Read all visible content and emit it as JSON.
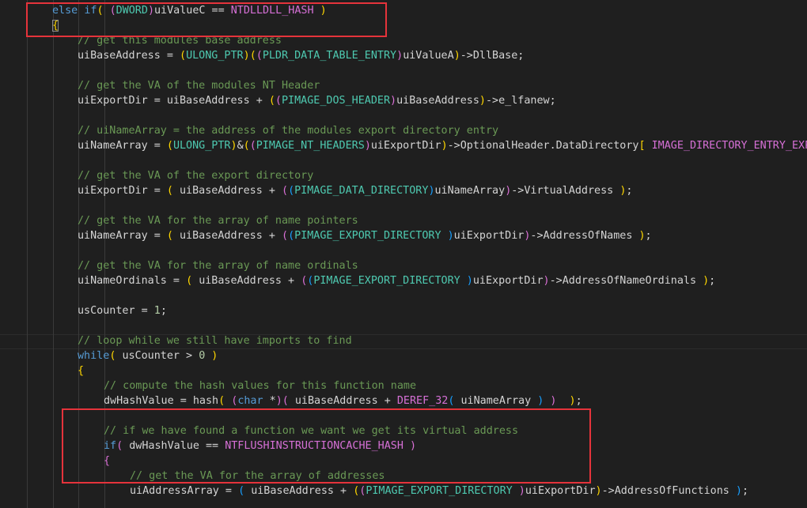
{
  "colors": {
    "background": "#1f1f1f",
    "keyword": "#569cd6",
    "comment": "#6a9955",
    "type": "#4ec9b0",
    "macro": "#d670d6",
    "bracket_gold": "#ffd700",
    "bracket_orchid": "#da70d6",
    "bracket_blue": "#179fff",
    "highlight_box": "#e5333b"
  },
  "code_lines": [
    [
      [
        "k",
        "else "
      ],
      [
        "k",
        "if"
      ],
      [
        "y",
        "( "
      ],
      [
        "m",
        "("
      ],
      [
        "t",
        "DWORD"
      ],
      [
        "m",
        ")"
      ],
      [
        "d",
        "uiValueC == "
      ],
      [
        "p",
        "NTDLLDLL_HASH"
      ],
      [
        "y",
        " )"
      ]
    ],
    [
      [
        "bm",
        "{"
      ]
    ],
    [
      [
        "c",
        "// get this modules base address"
      ]
    ],
    [
      [
        "d",
        "uiBaseAddress = "
      ],
      [
        "y",
        "("
      ],
      [
        "t",
        "ULONG_PTR"
      ],
      [
        "y",
        ")"
      ],
      [
        "y",
        "("
      ],
      [
        "m",
        "("
      ],
      [
        "t",
        "PLDR_DATA_TABLE_ENTRY"
      ],
      [
        "m",
        ")"
      ],
      [
        "d",
        "uiValueA"
      ],
      [
        "y",
        ")"
      ],
      [
        "d",
        "->DllBase;"
      ]
    ],
    [],
    [
      [
        "c",
        "// get the VA of the modules NT Header"
      ]
    ],
    [
      [
        "d",
        "uiExportDir = uiBaseAddress + "
      ],
      [
        "y",
        "("
      ],
      [
        "m",
        "("
      ],
      [
        "t",
        "PIMAGE_DOS_HEADER"
      ],
      [
        "m",
        ")"
      ],
      [
        "d",
        "uiBaseAddress"
      ],
      [
        "y",
        ")"
      ],
      [
        "d",
        "->e_lfanew;"
      ]
    ],
    [],
    [
      [
        "c",
        "// uiNameArray = the address of the modules export directory entry"
      ]
    ],
    [
      [
        "d",
        "uiNameArray = "
      ],
      [
        "y",
        "("
      ],
      [
        "t",
        "ULONG_PTR"
      ],
      [
        "y",
        ")"
      ],
      [
        "d",
        "&"
      ],
      [
        "y",
        "("
      ],
      [
        "m",
        "("
      ],
      [
        "t",
        "PIMAGE_NT_HEADERS"
      ],
      [
        "m",
        ")"
      ],
      [
        "d",
        "uiExportDir"
      ],
      [
        "y",
        ")"
      ],
      [
        "d",
        "->OptionalHeader.DataDirectory"
      ],
      [
        "y",
        "[ "
      ],
      [
        "p",
        "IMAGE_DIRECTORY_ENTRY_EXPORT"
      ],
      [
        "y",
        " ]"
      ],
      [
        "d",
        ";"
      ]
    ],
    [],
    [
      [
        "c",
        "// get the VA of the export directory"
      ]
    ],
    [
      [
        "d",
        "uiExportDir = "
      ],
      [
        "y",
        "( "
      ],
      [
        "d",
        "uiBaseAddress + "
      ],
      [
        "m",
        "("
      ],
      [
        "b",
        "("
      ],
      [
        "t",
        "PIMAGE_DATA_DIRECTORY"
      ],
      [
        "b",
        ")"
      ],
      [
        "d",
        "uiNameArray"
      ],
      [
        "m",
        ")"
      ],
      [
        "d",
        "->VirtualAddress "
      ],
      [
        "y",
        ")"
      ],
      [
        "d",
        ";"
      ]
    ],
    [],
    [
      [
        "c",
        "// get the VA for the array of name pointers"
      ]
    ],
    [
      [
        "d",
        "uiNameArray = "
      ],
      [
        "y",
        "( "
      ],
      [
        "d",
        "uiBaseAddress + "
      ],
      [
        "m",
        "("
      ],
      [
        "b",
        "("
      ],
      [
        "t",
        "PIMAGE_EXPORT_DIRECTORY "
      ],
      [
        "b",
        ")"
      ],
      [
        "d",
        "uiExportDir"
      ],
      [
        "m",
        ")"
      ],
      [
        "d",
        "->AddressOfNames "
      ],
      [
        "y",
        ")"
      ],
      [
        "d",
        ";"
      ]
    ],
    [],
    [
      [
        "c",
        "// get the VA for the array of name ordinals"
      ]
    ],
    [
      [
        "d",
        "uiNameOrdinals = "
      ],
      [
        "y",
        "( "
      ],
      [
        "d",
        "uiBaseAddress + "
      ],
      [
        "m",
        "("
      ],
      [
        "b",
        "("
      ],
      [
        "t",
        "PIMAGE_EXPORT_DIRECTORY "
      ],
      [
        "b",
        ")"
      ],
      [
        "d",
        "uiExportDir"
      ],
      [
        "m",
        ")"
      ],
      [
        "d",
        "->AddressOfNameOrdinals "
      ],
      [
        "y",
        ")"
      ],
      [
        "d",
        ";"
      ]
    ],
    [],
    [
      [
        "d",
        "usCounter = "
      ],
      [
        "n",
        "1"
      ],
      [
        "d",
        ";"
      ]
    ],
    [],
    [
      [
        "c",
        "// loop while we still have imports to find"
      ]
    ],
    [
      [
        "k",
        "while"
      ],
      [
        "y",
        "( "
      ],
      [
        "d",
        "usCounter > "
      ],
      [
        "n",
        "0"
      ],
      [
        "y",
        " )"
      ]
    ],
    [
      [
        "y",
        "{"
      ]
    ],
    [
      [
        "c",
        "// compute the hash values for this function name"
      ]
    ],
    [
      [
        "d",
        "dwHashValue = hash"
      ],
      [
        "y",
        "( "
      ],
      [
        "m",
        "("
      ],
      [
        "k",
        "char"
      ],
      [
        "d",
        " *"
      ],
      [
        "m",
        ")"
      ],
      [
        "m",
        "( "
      ],
      [
        "d",
        "uiBaseAddress + "
      ],
      [
        "p",
        "DEREF_32"
      ],
      [
        "b",
        "( "
      ],
      [
        "d",
        "uiNameArray "
      ],
      [
        "b",
        ")"
      ],
      [
        "m",
        " )"
      ],
      [
        "y",
        "  )"
      ],
      [
        "d",
        ";"
      ]
    ],
    [],
    [
      [
        "c",
        "// if we have found a function we want we get its virtual address"
      ]
    ],
    [
      [
        "k",
        "if"
      ],
      [
        "m",
        "( "
      ],
      [
        "d",
        "dwHashValue == "
      ],
      [
        "p",
        "NTFLUSHINSTRUCTIONCACHE_HASH"
      ],
      [
        "m",
        " )"
      ]
    ],
    [
      [
        "m",
        "{"
      ]
    ],
    [
      [
        "c",
        "// get the VA for the array of addresses"
      ]
    ],
    [
      [
        "d",
        "uiAddressArray = "
      ],
      [
        "b",
        "( "
      ],
      [
        "d",
        "uiBaseAddress + "
      ],
      [
        "y",
        "("
      ],
      [
        "m",
        "("
      ],
      [
        "t",
        "PIMAGE_EXPORT_DIRECTORY "
      ],
      [
        "m",
        ")"
      ],
      [
        "d",
        "uiExportDir"
      ],
      [
        "y",
        ")"
      ],
      [
        "d",
        "->AddressOfFunctions "
      ],
      [
        "b",
        ")"
      ],
      [
        "d",
        ";"
      ]
    ]
  ]
}
